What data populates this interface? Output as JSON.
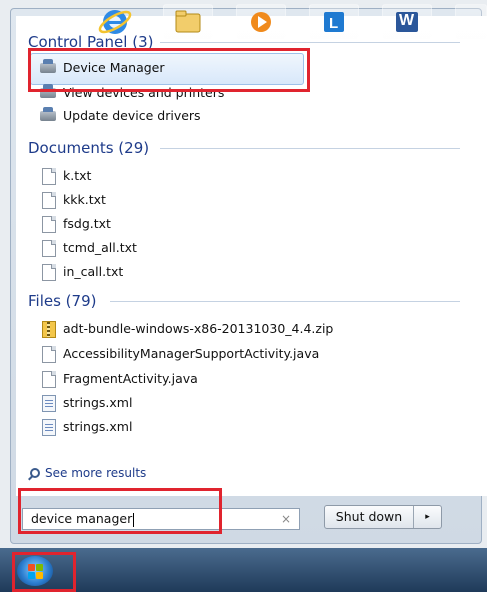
{
  "sections": {
    "control_panel": {
      "heading": "Control Panel (3)",
      "items": [
        "Device Manager",
        "View devices and printers",
        "Update device drivers"
      ]
    },
    "documents": {
      "heading": "Documents (29)",
      "items": [
        "k.txt",
        "kkk.txt",
        "fsdg.txt",
        "tcmd_all.txt",
        "in_call.txt"
      ]
    },
    "files": {
      "heading": "Files (79)",
      "items": [
        "adt-bundle-windows-x86-20131030_4.4.zip",
        "AccessibilityManagerSupportActivity.java",
        "FragmentActivity.java",
        "strings.xml",
        "strings.xml"
      ]
    }
  },
  "see_more": "See more results",
  "search": {
    "value": "device manager",
    "clear_symbol": "×"
  },
  "shutdown": {
    "label": "Shut down",
    "arrow": "▸"
  },
  "taskbar": {
    "word_label": "W",
    "icons": [
      "windows-start-icon",
      "internet-explorer-icon",
      "file-explorer-icon",
      "media-player-icon",
      "lync-icon",
      "word-icon"
    ]
  },
  "colors": {
    "highlight": "#e0242e",
    "section_heading": "#1e3b8a"
  }
}
